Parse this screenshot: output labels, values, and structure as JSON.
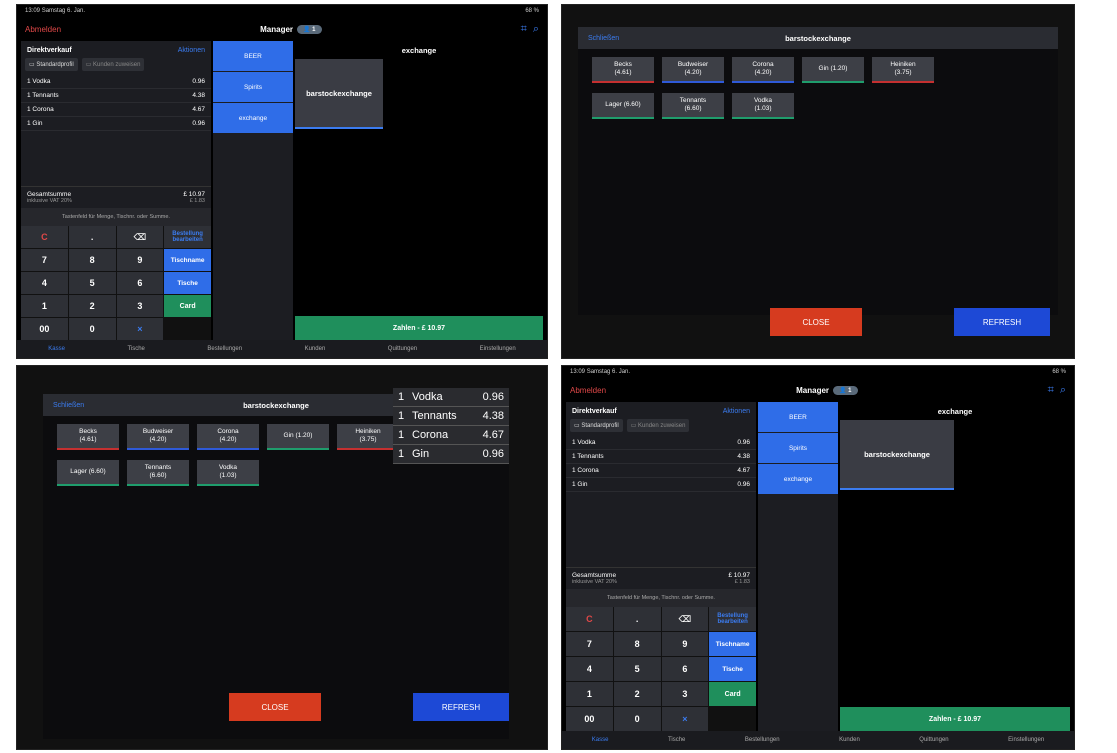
{
  "status": {
    "time": "13:09",
    "date": "Samstag 6. Jan.",
    "battery": "68 %"
  },
  "top": {
    "logout": "Abmelden",
    "manager": "Manager",
    "badge": "1"
  },
  "order": {
    "title": "Direktverkauf",
    "actions": "Aktionen",
    "profile": "Standardprofil",
    "assign": "Kunden zuweisen",
    "lines": [
      {
        "label": "1 Vodka",
        "price": "0.96"
      },
      {
        "label": "1 Tennants",
        "price": "4.38"
      },
      {
        "label": "1 Corona",
        "price": "4.67"
      },
      {
        "label": "1 Gin",
        "price": "0.96"
      }
    ],
    "total_label": "Gesamtsumme",
    "total": "£ 10.97",
    "vat_label": "inklusive VAT 20%",
    "vat": "£ 1.83"
  },
  "keypad": {
    "hint": "Tastenfeld für Menge, Tischnr. oder Summe.",
    "keys": [
      "C",
      ".",
      "⌫",
      "7",
      "8",
      "9",
      "4",
      "5",
      "6",
      "1",
      "2",
      "3",
      "00",
      "0",
      "×"
    ],
    "edit_order": "Bestellung bearbeiten",
    "table_name": "Tischname",
    "tables": "Tische",
    "card": "Card"
  },
  "categories": [
    "BEER",
    "Spirits",
    "exchange"
  ],
  "main": {
    "title": "exchange",
    "tile": "barstockexchange",
    "pay": "Zahlen - £ 10.97"
  },
  "nav": [
    "Kasse",
    "Tische",
    "Bestellungen",
    "Kunden",
    "Quittungen",
    "Einstellungen"
  ],
  "modal": {
    "close_link": "Schließen",
    "title": "barstockexchange",
    "products": [
      {
        "label": "Becks\n(4.61)",
        "color": "red"
      },
      {
        "label": "Budweiser\n(4.20)",
        "color": "blue"
      },
      {
        "label": "Corona\n(4.20)",
        "color": "blue"
      },
      {
        "label": "Gin (1.20)",
        "color": "green"
      },
      {
        "label": "Heiniken\n(3.75)",
        "color": "red"
      },
      {
        "label": "Lager (6.60)",
        "color": "green"
      },
      {
        "label": "Tennants\n(6.60)",
        "color": "green"
      },
      {
        "label": "Vodka\n(1.03)",
        "color": "green"
      }
    ],
    "close_button": "CLOSE",
    "refresh_button": "REFRESH"
  },
  "info": [
    {
      "qty": "1",
      "name": "Vodka",
      "price": "0.96"
    },
    {
      "qty": "1",
      "name": "Tennants",
      "price": "4.38"
    },
    {
      "qty": "1",
      "name": "Corona",
      "price": "4.67"
    },
    {
      "qty": "1",
      "name": "Gin",
      "price": "0.96"
    }
  ]
}
